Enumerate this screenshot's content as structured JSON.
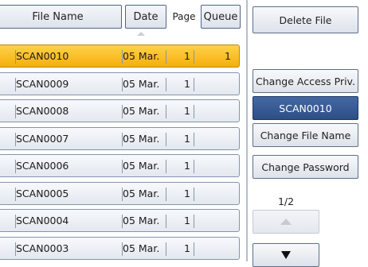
{
  "header": {
    "file_name_label": "File Name",
    "date_label": "Date",
    "page_label": "Page",
    "queue_label": "Queue"
  },
  "files": [
    {
      "name": "SCAN0010",
      "date": "05 Mar.",
      "page": "1",
      "queue": "1",
      "selected": true
    },
    {
      "name": "SCAN0009",
      "date": "05 Mar.",
      "page": "1",
      "queue": "",
      "selected": false
    },
    {
      "name": "SCAN0008",
      "date": "05 Mar.",
      "page": "1",
      "queue": "",
      "selected": false
    },
    {
      "name": "SCAN0007",
      "date": "05 Mar.",
      "page": "1",
      "queue": "",
      "selected": false
    },
    {
      "name": "SCAN0006",
      "date": "05 Mar.",
      "page": "1",
      "queue": "",
      "selected": false
    },
    {
      "name": "SCAN0005",
      "date": "05 Mar.",
      "page": "1",
      "queue": "",
      "selected": false
    },
    {
      "name": "SCAN0004",
      "date": "05 Mar.",
      "page": "1",
      "queue": "",
      "selected": false
    },
    {
      "name": "SCAN0003",
      "date": "05 Mar.",
      "page": "1",
      "queue": "",
      "selected": false
    }
  ],
  "side": {
    "delete_file": "Delete File",
    "change_access": "Change Access Priv.",
    "selected_file": "SCAN0010",
    "change_file_name": "Change File Name",
    "change_password": "Change Password",
    "page_indicator": "1/2",
    "up_icon": "triangle-up-icon",
    "down_icon": "triangle-down-icon"
  },
  "colors": {
    "selected_row": "#f5ae0c",
    "selected_file_button": "#2d4f86"
  }
}
